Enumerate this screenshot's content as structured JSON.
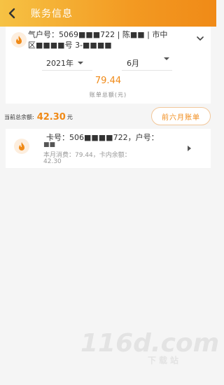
{
  "header": {
    "title": "账务信息"
  },
  "account": {
    "info_line1": "气户号：5069■■■722 | 陈■■ | 市中",
    "info_line2": "区■■■■号 3-■■■■"
  },
  "filters": {
    "year": "2021年",
    "month": "6月"
  },
  "bill": {
    "total": "79.44",
    "total_label": "账单总额(元)"
  },
  "balance": {
    "label": "当前总余额:",
    "value": "42.30",
    "unit": "元",
    "history_button": "前六月账单"
  },
  "card": {
    "line1": "卡号：506■■■■722，户号：",
    "line2": "■■",
    "line3": "本月消费：79.44，卡内余额：",
    "line4": "42.30"
  },
  "watermark": {
    "main": "116d.com",
    "sub": "下载站"
  },
  "colors": {
    "accent": "#f08a17",
    "header_start": "#f6c244",
    "header_end": "#f08a17"
  }
}
